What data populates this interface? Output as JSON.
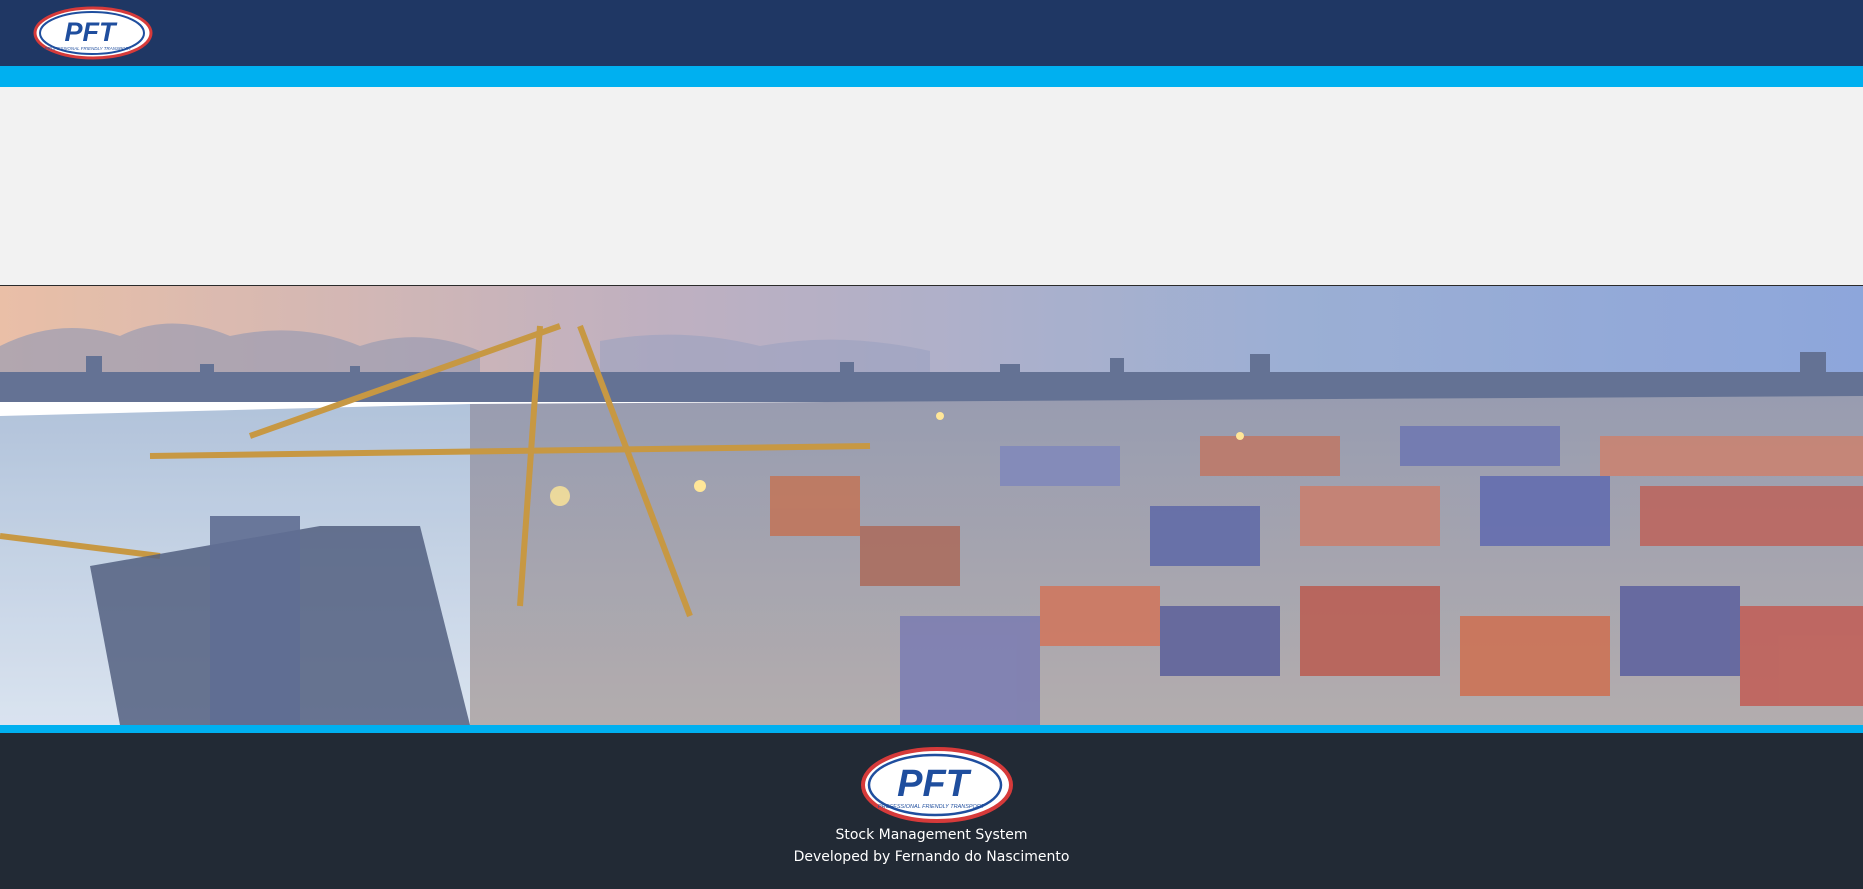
{
  "header": {
    "logo": {
      "icon": "pft-logo-icon",
      "text": "PFT",
      "tagline": "PROFESSIONAL FRIENDLY TRANSPORT"
    }
  },
  "banner": {
    "icon": "container-port-photo"
  },
  "footer": {
    "logo": {
      "icon": "pft-logo-icon",
      "text": "PFT",
      "tagline": "PROFESSIONAL FRIENDLY TRANSPORT"
    },
    "system_name": "Stock Management System",
    "credit": "Developed by Fernando do Nascimento"
  },
  "colors": {
    "header_bg": "#1f3764",
    "accent": "#00b0f0",
    "content_bg": "#f2f2f2",
    "footer_bg": "#222a35"
  }
}
